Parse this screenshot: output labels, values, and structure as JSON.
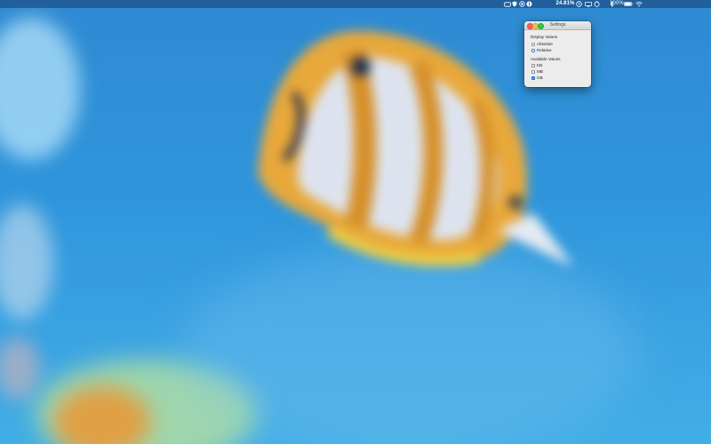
{
  "menubar": {
    "icons": [
      "vr-icon",
      "shield-icon",
      "circle-icon",
      "coin-icon",
      "clock-icon",
      "airplay-icon",
      "timer-icon",
      "bluetooth-icon",
      "wifi-icon",
      "battery-icon"
    ],
    "usage_value": "24.81%",
    "battery_value": "100%"
  },
  "settings_window": {
    "title": "Settings",
    "display_values": {
      "label": "Display Values",
      "options": [
        {
          "label": "Absolute",
          "selected": false
        },
        {
          "label": "Relative",
          "selected": true
        }
      ]
    },
    "available_values": {
      "label": "Available Values",
      "options": [
        {
          "label": "KB",
          "checked": false
        },
        {
          "label": "MB",
          "checked": false
        },
        {
          "label": "GB",
          "checked": true
        }
      ]
    }
  },
  "colors": {
    "desktop_blue": "#2f8ad2",
    "fish_orange": "#e8a83a",
    "selection_blue": "#3d8ef5"
  }
}
